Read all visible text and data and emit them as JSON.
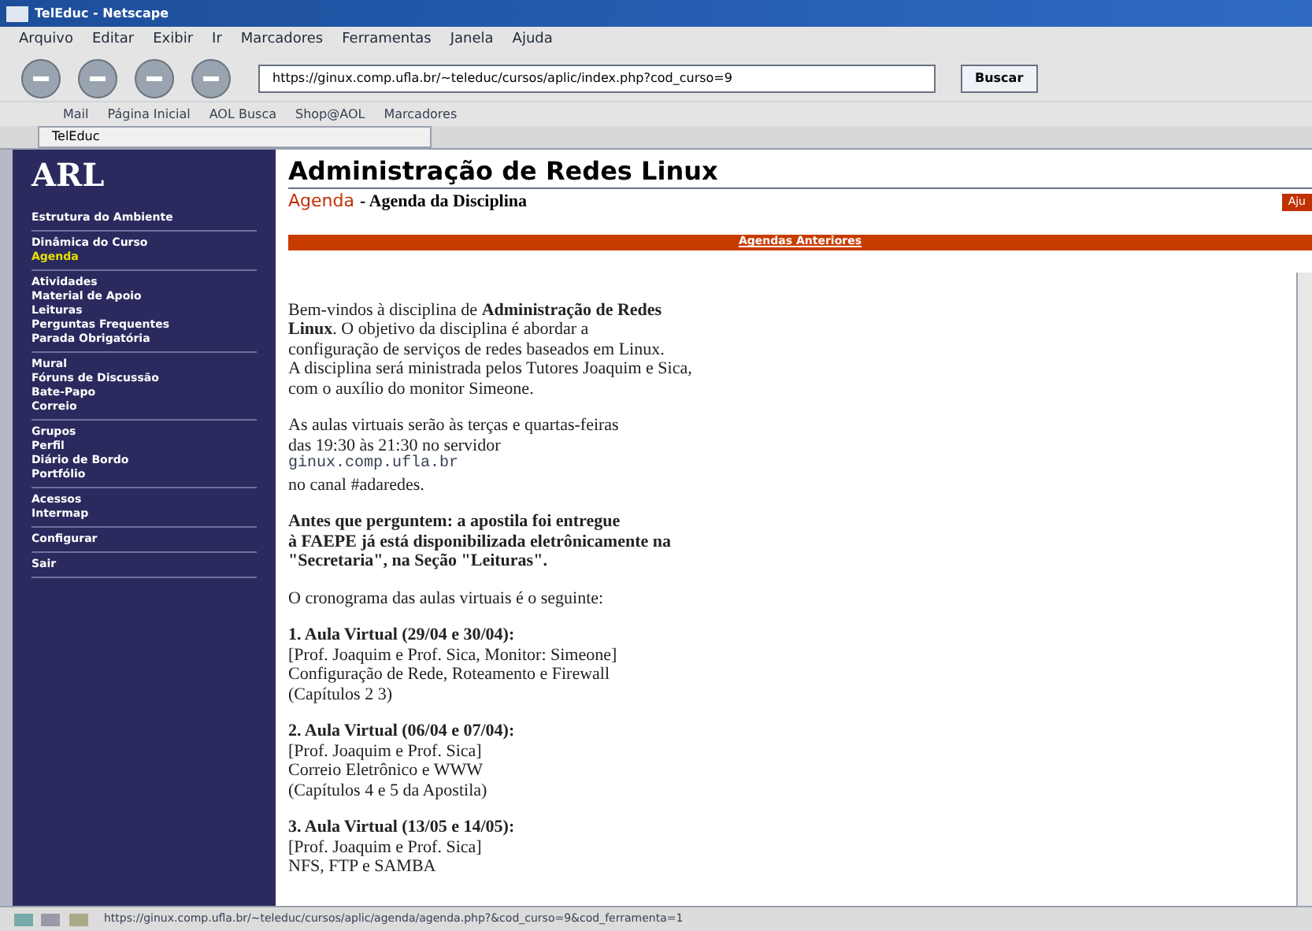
{
  "window": {
    "title": "TelEduc - Netscape"
  },
  "menu": [
    "Arquivo",
    "Editar",
    "Exibir",
    "Ir",
    "Marcadores",
    "Ferramentas",
    "Janela",
    "Ajuda"
  ],
  "address": {
    "value": "https://ginux.comp.ufla.br/~teleduc/cursos/aplic/index.php?cod_curso=9"
  },
  "search_button": "Buscar",
  "bookmarks": [
    "Mail",
    "Página Inicial",
    "AOL Busca",
    "Shop@AOL",
    "Marcadores"
  ],
  "tabs": [
    {
      "label": "TelEduc",
      "selected": true
    }
  ],
  "sidebar": {
    "logo": "ARL",
    "groups": [
      [
        {
          "label": "Estrutura do Ambiente",
          "selected": false
        }
      ],
      [
        {
          "label": "Dinâmica do Curso",
          "selected": false
        },
        {
          "label": "Agenda",
          "selected": true
        }
      ],
      [
        {
          "label": "Atividades",
          "selected": false
        },
        {
          "label": "Material de Apoio",
          "selected": false
        },
        {
          "label": "Leituras",
          "selected": false
        },
        {
          "label": "Perguntas Frequentes",
          "selected": false
        },
        {
          "label": "Parada Obrigatória",
          "selected": false
        }
      ],
      [
        {
          "label": "Mural",
          "selected": false
        },
        {
          "label": "Fóruns de Discussão",
          "selected": false
        },
        {
          "label": "Bate-Papo",
          "selected": false
        },
        {
          "label": "Correio",
          "selected": false
        }
      ],
      [
        {
          "label": "Grupos",
          "selected": false
        },
        {
          "label": "Perfil",
          "selected": false
        },
        {
          "label": "Diário de Bordo",
          "selected": false
        },
        {
          "label": "Portfólio",
          "selected": false
        }
      ],
      [
        {
          "label": "Acessos",
          "selected": false
        },
        {
          "label": "Intermap",
          "selected": false
        }
      ],
      [
        {
          "label": "Configurar",
          "selected": false
        }
      ],
      [
        {
          "label": "Sair",
          "selected": false
        }
      ]
    ]
  },
  "page": {
    "title": "Administração de Redes Linux",
    "section": "Agenda",
    "subtitle": "- Agenda da Disciplina",
    "help_button": "Aju",
    "bar_link": "Agendas Anteriores",
    "paragraphs": [
      [
        "Bem-vindos à disciplina de **Administração de Redes**",
        "**Linux**. O objetivo da disciplina é abordar a",
        "configuração de serviços de redes baseados em Linux.",
        "A disciplina será ministrada pelos Tutores Joaquim e Sica,",
        "com o auxílio do monitor Simeone."
      ],
      [
        "As aulas virtuais serão às terças e quartas-feiras",
        "das 19:30 às 21:30 no servidor",
        {
          "kind": "code",
          "text": "ginux.comp.ufla.br"
        },
        "no canal #adaredes."
      ],
      [
        "**Antes que perguntem: a apostila foi entregue**",
        "**à FAEPE já está disponibilizada eletrônicamente na**",
        "**\"Secretaria\", na Seção \"Leituras\".**"
      ],
      [
        "O cronograma das aulas virtuais é o seguinte:"
      ],
      [
        "**1. Aula Virtual (29/04 e 30/04):**",
        "[Prof. Joaquim e Prof. Sica, Monitor: Simeone]",
        "Configuração de Rede, Roteamento e Firewall",
        "(Capítulos 2 3)"
      ],
      [
        "**2. Aula Virtual (06/04 e 07/04):**",
        "[Prof. Joaquim e Prof. Sica]",
        "Correio Eletrônico e WWW",
        "(Capítulos 4 e 5 da Apostila)"
      ],
      [
        "**3. Aula Virtual (13/05 e 14/05):**",
        "[Prof. Joaquim e Prof. Sica]",
        "NFS, FTP e SAMBA"
      ]
    ]
  },
  "status_bar": {
    "url": "https://ginux.comp.ufla.br/~teleduc/cursos/aplic/agenda/agenda.php?&cod_curso=9&cod_ferramenta=1"
  }
}
